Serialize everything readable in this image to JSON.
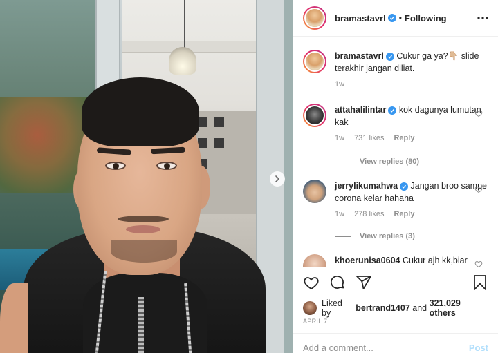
{
  "post": {
    "username": "bramastavrl",
    "follow_status": "Following",
    "dot": "•",
    "caption": "Cukur ga ya?👇🏼 slide terakhir jangan diliat.",
    "caption_time": "1w"
  },
  "comments": [
    {
      "username": "attahalilintar",
      "verified": true,
      "text": "kok dagunya lumutan kak",
      "time": "1w",
      "likes": "731 likes",
      "reply_label": "Reply",
      "view_replies": "View replies (80)"
    },
    {
      "username": "jerrylikumahwa",
      "verified": true,
      "text": "Jangan broo sampe corona kelar hahaha",
      "time": "1w",
      "likes": "278 likes",
      "reply_label": "Reply",
      "view_replies": "View replies (3)"
    },
    {
      "username": "khoerunisa0604",
      "verified": false,
      "text": "Cukur ajh kk,biar"
    }
  ],
  "likes_line": {
    "prefix": "Liked by",
    "user": "bertrand1407",
    "middle": "and",
    "count": "321,029 others"
  },
  "date": "APRIL 7",
  "comment_box": {
    "placeholder": "Add a comment...",
    "post_label": "Post"
  },
  "colors": {
    "verified": "#3897f0",
    "post_disabled": "#b2dffc",
    "meta_gray": "#8e8e8e"
  },
  "icons": [
    "more-options-icon",
    "verified-badge-icon",
    "heart-icon",
    "comment-icon",
    "share-icon",
    "bookmark-icon",
    "next-slide-chevron-icon"
  ]
}
